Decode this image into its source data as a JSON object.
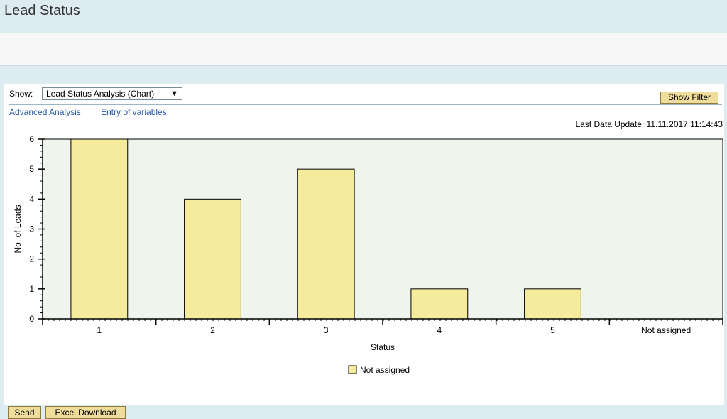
{
  "page": {
    "title": "Lead Status"
  },
  "view": {
    "show_label": "Show:",
    "selected": "Lead Status Analysis (Chart)",
    "show_filter_label": "Show Filter"
  },
  "links": {
    "advanced_analysis": "Advanced Analysis",
    "entry_of_variables": "Entry of variables"
  },
  "last_update": "Last Data Update: 11.11.2017 11:14:43",
  "buttons": {
    "send": "Send",
    "excel_download": "Excel Download"
  },
  "chart_data": {
    "type": "bar",
    "categories": [
      "1",
      "2",
      "3",
      "4",
      "5",
      "Not assigned"
    ],
    "series": [
      {
        "name": "Not assigned",
        "values": [
          6,
          4,
          5,
          1,
          1,
          0
        ],
        "color": "#f5eb9c"
      }
    ],
    "xlabel": "Status",
    "ylabel": "No. of Leads",
    "ylim": [
      0,
      6
    ],
    "yticks": [
      0,
      1,
      2,
      3,
      4,
      5,
      6
    ],
    "plot_background": "#eff4ed",
    "legend_position": "bottom-center"
  }
}
